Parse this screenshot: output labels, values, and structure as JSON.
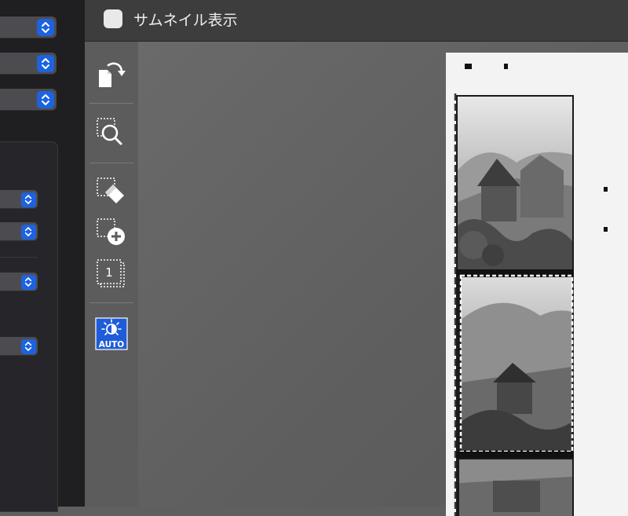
{
  "toolbar": {
    "thumbnail_label": "サムネイル表示",
    "thumbnail_checked": false
  },
  "tools": [
    {
      "name": "rotate-icon"
    },
    {
      "name": "zoom-selection-icon"
    },
    {
      "name": "erase-selection-icon"
    },
    {
      "name": "add-selection-icon"
    },
    {
      "name": "frame-number-icon",
      "label": "1"
    },
    {
      "name": "auto-exposure-icon",
      "label": "AUTO"
    }
  ],
  "colors": {
    "accent": "#1d63e0",
    "panel": "#1f1f22",
    "toolbar": "#3d3d3d",
    "preview": "#5f5f5f",
    "auto_icon_bg": "#1e5cd8"
  }
}
